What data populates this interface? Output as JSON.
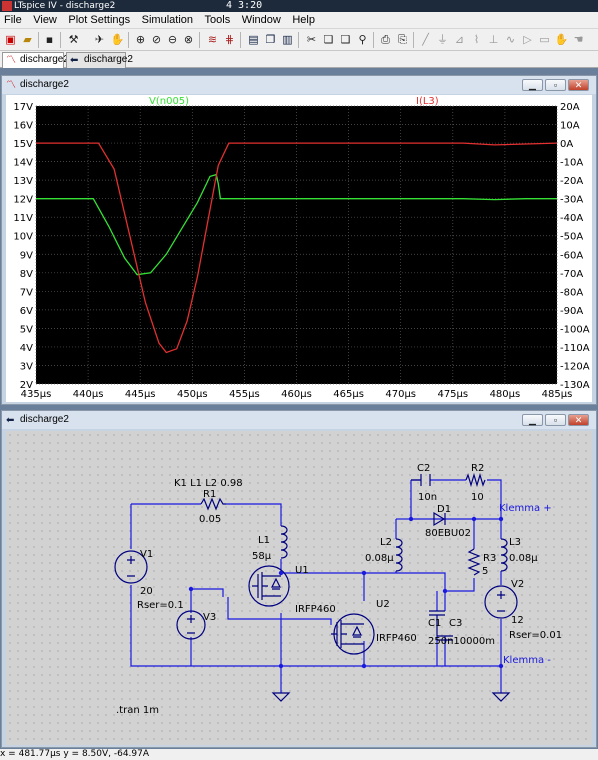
{
  "app": {
    "window_title": "LTspice IV - discharge2",
    "clock": "4 3:20"
  },
  "menu": [
    "File",
    "View",
    "Plot Settings",
    "Simulation",
    "Tools",
    "Window",
    "Help"
  ],
  "toolbar_icons": [
    "new-schematic-icon",
    "open-icon",
    "save-icon",
    "control-panel-icon",
    "run-icon",
    "halt-icon",
    "zoom-in-icon",
    "zoom-rect-icon",
    "zoom-out-icon",
    "zoom-fit-icon",
    "autorange-icon",
    "grid-icon",
    "tile-horizontal-icon",
    "cascade-icon",
    "tile-vertical-icon",
    "cut-icon",
    "copy-icon",
    "paste-icon",
    "find-icon",
    "print-icon",
    "print-setup-icon",
    "wire-icon",
    "ground-icon",
    "label-icon",
    "resistor-icon",
    "capacitor-icon",
    "inductor-icon",
    "diode-icon",
    "component-icon",
    "move-icon",
    "drag-icon",
    "undo-icon",
    "redo-icon",
    "rotate-icon",
    "mirror-icon",
    "text-icon",
    "spice-directive-icon"
  ],
  "tabs": [
    {
      "label": "discharge2",
      "icon": "waveform-icon",
      "active": true
    },
    {
      "label": "discharge2",
      "icon": "schematic-icon",
      "active": false
    }
  ],
  "plot_window": {
    "title": "discharge2",
    "icon": "waveform-icon",
    "trace1_label": "V(n005)",
    "trace2_label": "I(L3)"
  },
  "chart_data": {
    "type": "line",
    "xlabel": "",
    "ylabel": "",
    "xlim": [
      435,
      485
    ],
    "ylim_left": [
      2,
      17
    ],
    "ylim_right": [
      -130,
      20
    ],
    "x_ticks": [
      "435µs",
      "440µs",
      "445µs",
      "450µs",
      "455µs",
      "460µs",
      "465µs",
      "470µs",
      "475µs",
      "480µs",
      "485µs"
    ],
    "y_left_ticks": [
      "17V",
      "16V",
      "15V",
      "14V",
      "13V",
      "12V",
      "11V",
      "10V",
      "9V",
      "8V",
      "7V",
      "6V",
      "5V",
      "4V",
      "3V",
      "2V"
    ],
    "y_right_ticks": [
      "20A",
      "10A",
      "0A",
      "-10A",
      "-20A",
      "-30A",
      "-40A",
      "-50A",
      "-60A",
      "-70A",
      "-80A",
      "-90A",
      "-100A",
      "-110A",
      "-120A",
      "-130A"
    ],
    "grid": true,
    "background": "#000000",
    "series": [
      {
        "name": "V(n005)",
        "axis": "left",
        "color": "#35e135",
        "x": [
          435,
          440.5,
          442,
          443.5,
          444.7,
          446,
          447.5,
          449,
          450.5,
          451.7,
          452.3,
          452.5,
          452.7,
          460,
          470,
          476,
          479,
          482,
          485
        ],
        "y": [
          12.0,
          12.0,
          10.5,
          8.8,
          7.9,
          8.0,
          9.0,
          10.4,
          11.8,
          13.2,
          13.3,
          12.8,
          12.0,
          12.0,
          12.0,
          12.0,
          11.95,
          12.0,
          12.0
        ]
      },
      {
        "name": "I(L3)",
        "axis": "right",
        "color": "#e33030",
        "x": [
          435,
          441,
          442.5,
          444,
          445.5,
          446.8,
          447.5,
          448.5,
          449.5,
          450.5,
          451.5,
          452.5,
          453.5,
          460,
          470,
          476,
          479,
          482,
          485
        ],
        "y": [
          0,
          0,
          -14,
          -50,
          -86,
          -108,
          -113,
          -111,
          -96,
          -72,
          -42,
          -12,
          0,
          0,
          0,
          0,
          -1,
          -0.5,
          0
        ]
      }
    ]
  },
  "schematic_window": {
    "title": "discharge2",
    "icon": "schematic-icon",
    "labels": {
      "coupling": "K1 L1 L2 0.98",
      "r1": "R1",
      "r1_val": "0.05",
      "l1": "L1",
      "l1_val": "58µ",
      "v1": "V1",
      "v1_val": "20",
      "v1_rser": "Rser=0.1",
      "v3": "V3",
      "u1": "U1",
      "u1_part": "IRFP460",
      "u2": "U2",
      "u2_part": "IRFP460",
      "c2": "C2",
      "c2_val": "10n",
      "r2": "R2",
      "r2_val": "10",
      "d1": "D1",
      "d1_part": "80EBU02",
      "klemma_plus": "Klemma +",
      "l2": "L2",
      "l2_val": "0.08µ",
      "r3": "R3",
      "r3_val": "5",
      "l3": "L3",
      "l3_val": "0.08µ",
      "v2": "V2",
      "v2_val": "12",
      "v2_rser": "Rser=0.01",
      "c1": "C1",
      "c3": "C3",
      "c1c3_val": "250n10000m",
      "klemma_minus": "Klemma -",
      "tran": ".tran 1m"
    }
  },
  "status": {
    "cursor_readout": "x = 481.77µs   y = 8.50V, -64.97A"
  },
  "colors": {
    "wire": "#1a1ae0",
    "component": "#000080",
    "grid_line": "#5a5a5a",
    "trace_green": "#35e135",
    "trace_red": "#e33030"
  }
}
